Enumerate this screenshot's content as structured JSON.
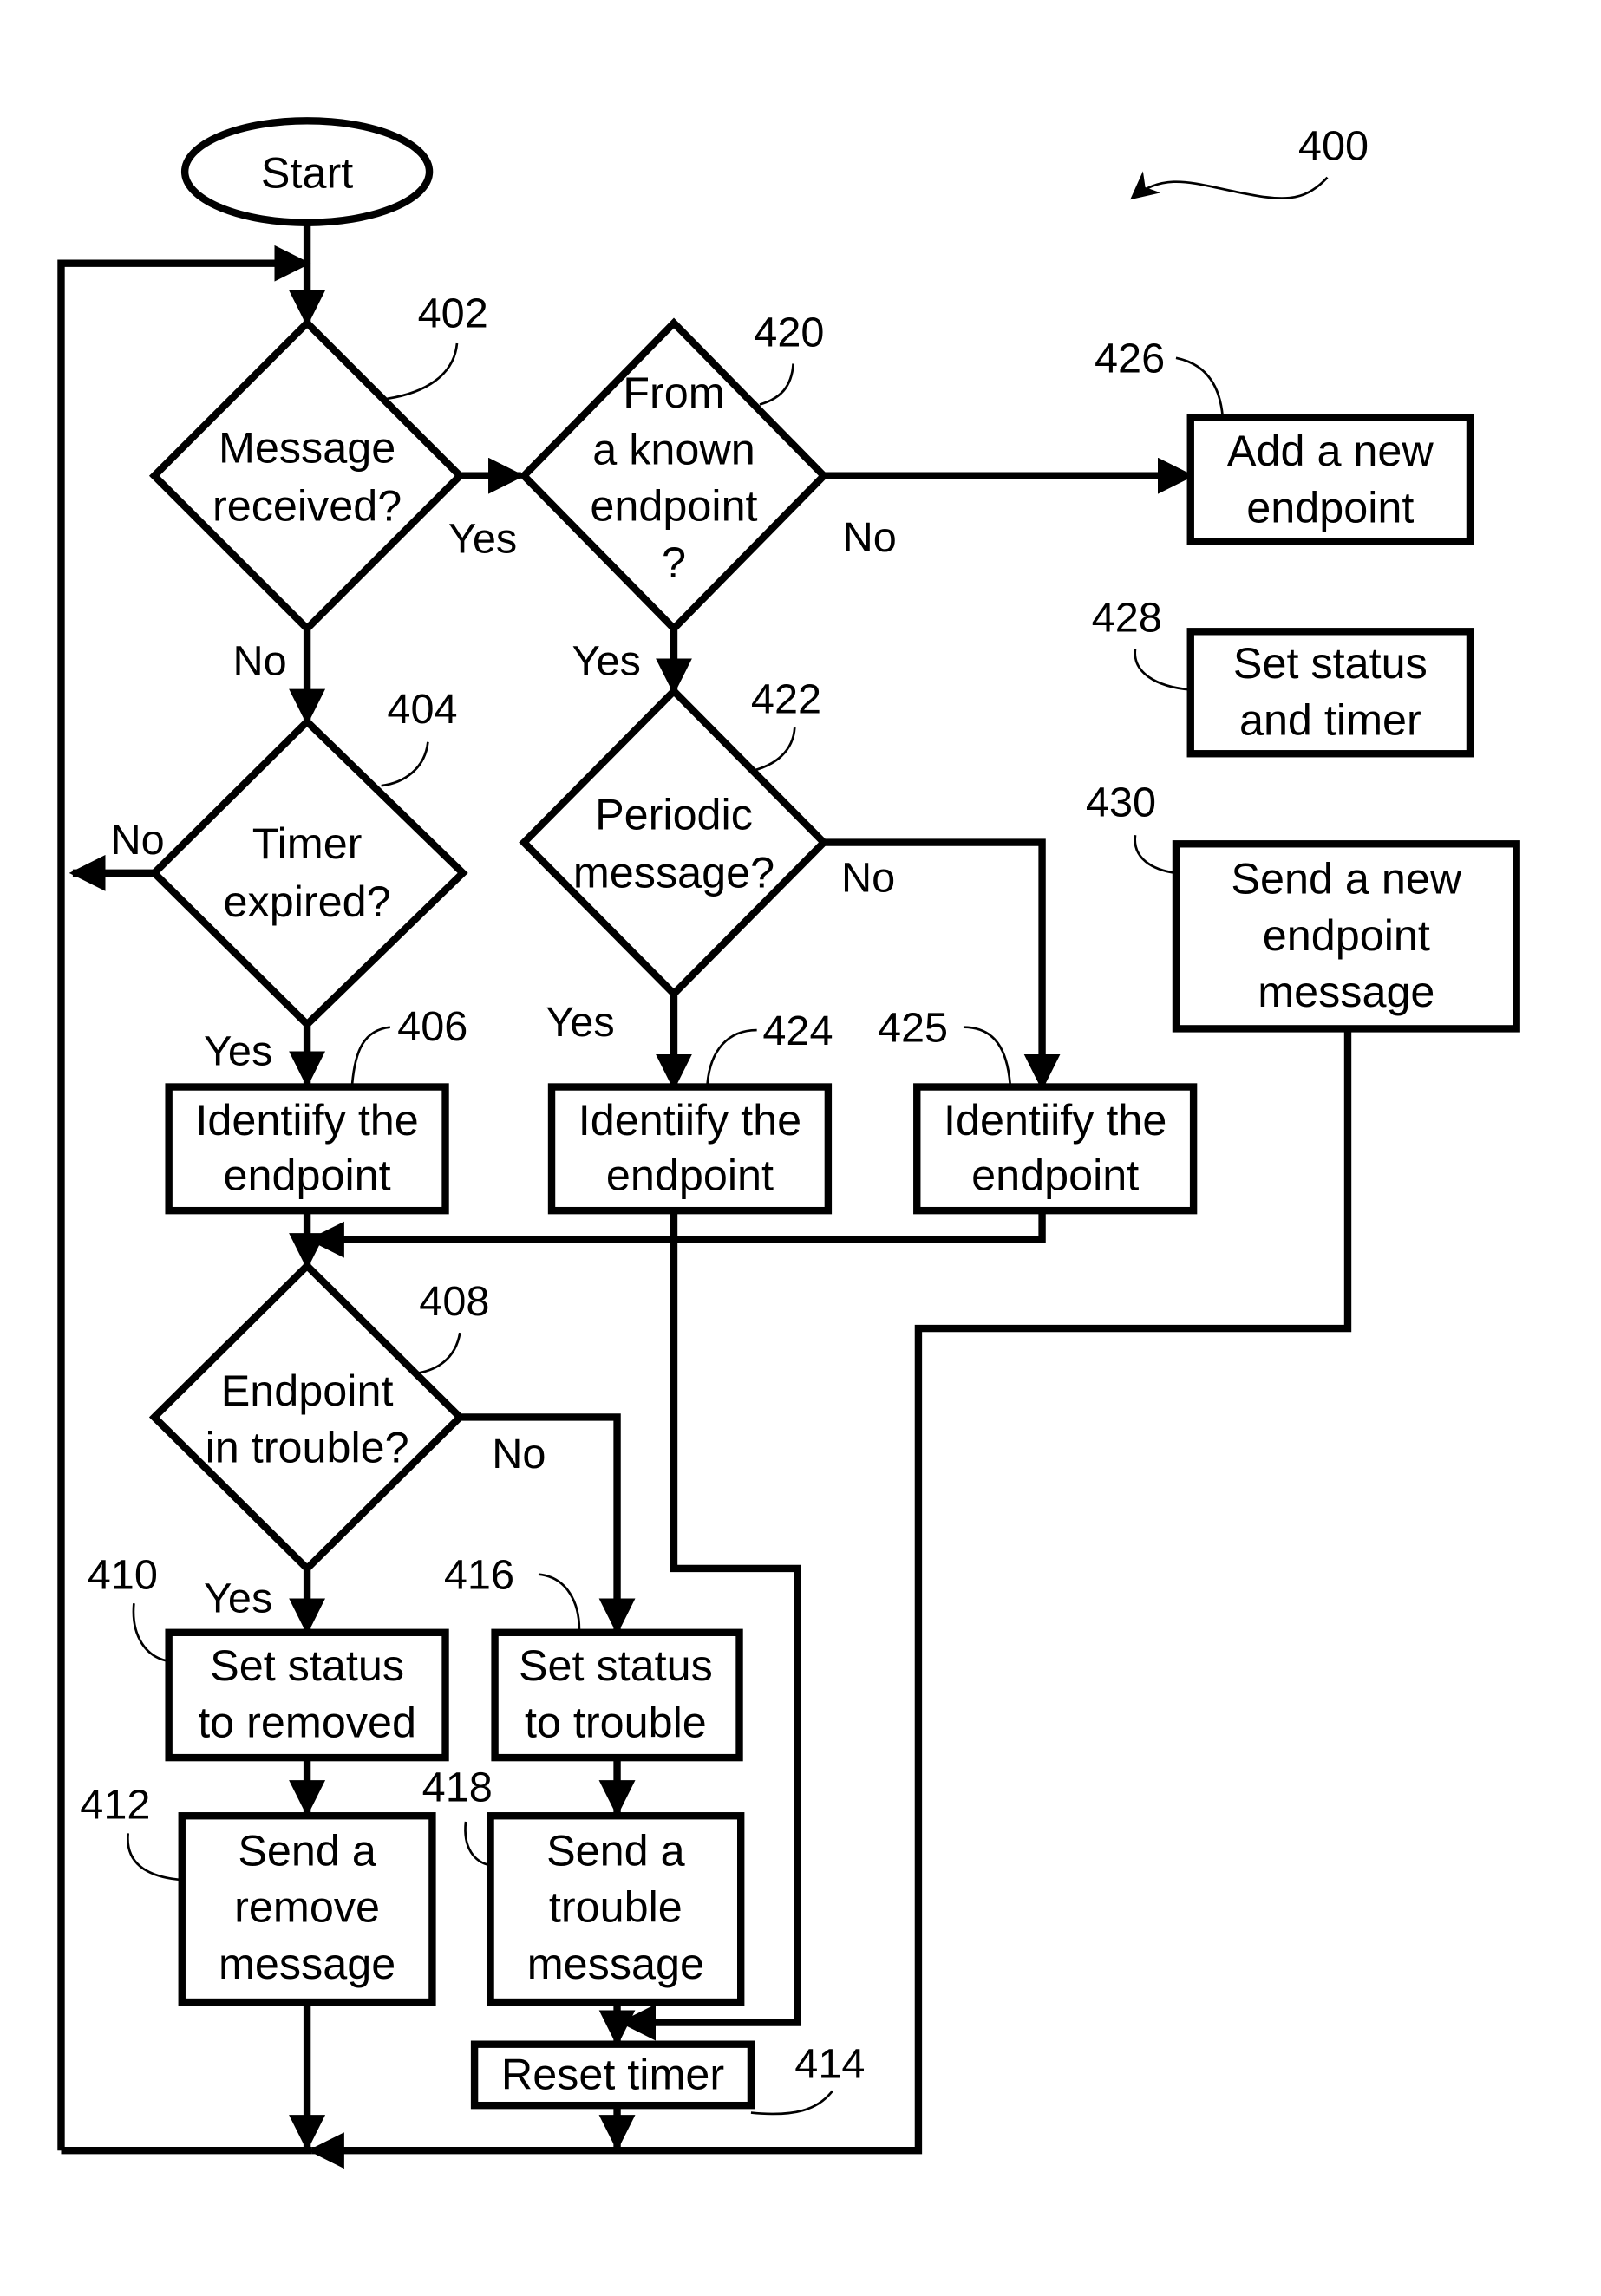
{
  "figure": {
    "ref": "400",
    "start": {
      "label": "Start"
    },
    "nodes": {
      "n402": {
        "ref": "402",
        "lines": [
          "Message",
          "received?"
        ]
      },
      "n404": {
        "ref": "404",
        "lines": [
          "Timer",
          "expired?"
        ]
      },
      "n406": {
        "ref": "406",
        "lines": [
          "Identiify the",
          "endpoint"
        ]
      },
      "n408": {
        "ref": "408",
        "lines": [
          "Endpoint",
          "in trouble?"
        ]
      },
      "n410": {
        "ref": "410",
        "lines": [
          "Set status",
          "to removed"
        ]
      },
      "n412": {
        "ref": "412",
        "lines": [
          "Send a",
          "remove",
          "message"
        ]
      },
      "n414": {
        "ref": "414",
        "lines": [
          "Reset timer"
        ]
      },
      "n416": {
        "ref": "416",
        "lines": [
          "Set status",
          "to trouble"
        ]
      },
      "n418": {
        "ref": "418",
        "lines": [
          "Send a",
          "trouble",
          "message"
        ]
      },
      "n420": {
        "ref": "420",
        "lines": [
          "From",
          "a known",
          "endpoint",
          "?"
        ]
      },
      "n422": {
        "ref": "422",
        "lines": [
          "Periodic",
          "message?"
        ]
      },
      "n424": {
        "ref": "424",
        "lines": [
          "Identiify the",
          "endpoint"
        ]
      },
      "n425": {
        "ref": "425",
        "lines": [
          "Identiify the",
          "endpoint"
        ]
      },
      "n426": {
        "ref": "426",
        "lines": [
          "Add a new",
          "endpoint"
        ]
      },
      "n428": {
        "ref": "428",
        "lines": [
          "Set status",
          "and timer"
        ]
      },
      "n430": {
        "ref": "430",
        "lines": [
          "Send a new",
          "endpoint",
          "message"
        ]
      }
    },
    "branches": {
      "b402_yes": "Yes",
      "b402_no": "No",
      "b404_no": "No",
      "b404_yes": "Yes",
      "b420_no": "No",
      "b420_yes": "Yes",
      "b422_no": "No",
      "b422_yes": "Yes",
      "b408_no": "No",
      "b408_yes": "Yes"
    }
  }
}
